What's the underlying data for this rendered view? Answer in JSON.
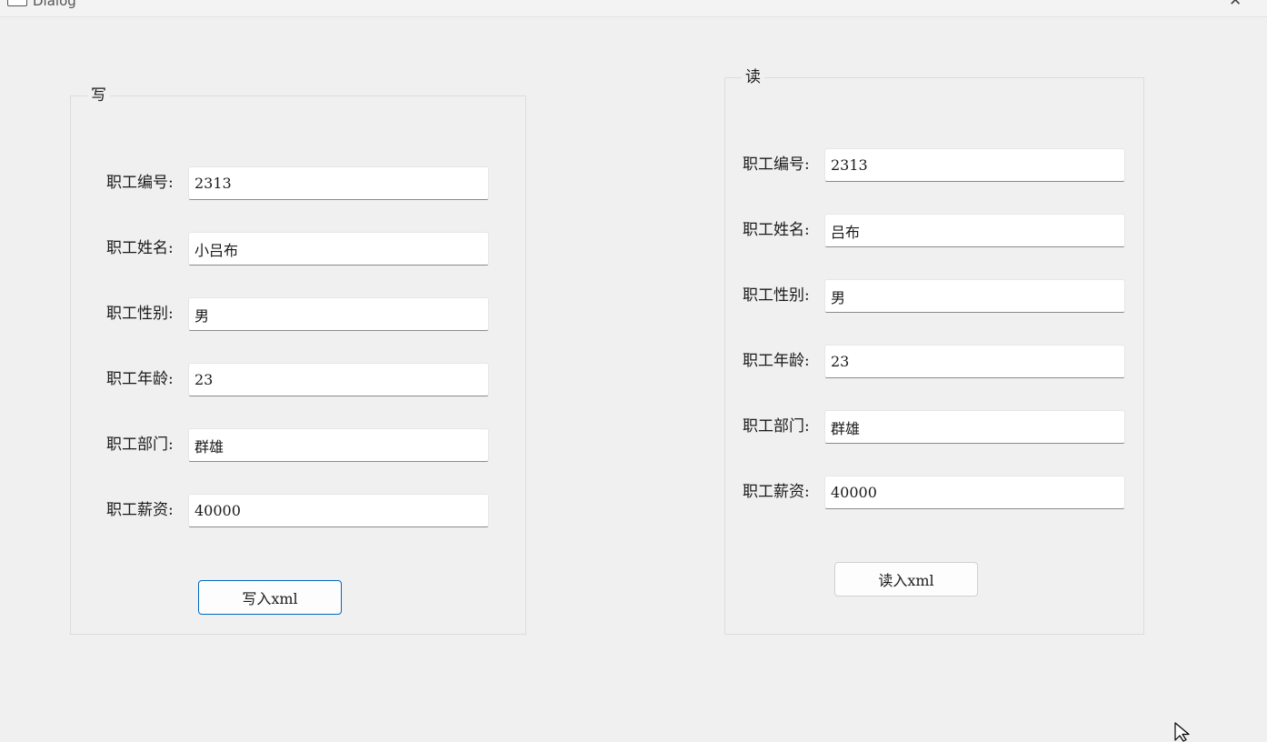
{
  "window": {
    "title": "Dialog",
    "minimize_glyph": "–",
    "close_glyph": "✕"
  },
  "write_group": {
    "title": "写",
    "fields": [
      {
        "label": "职工编号:",
        "value": "2313"
      },
      {
        "label": "职工姓名:",
        "value": "小吕布"
      },
      {
        "label": "职工性别:",
        "value": "男"
      },
      {
        "label": "职工年龄:",
        "value": "23"
      },
      {
        "label": "职工部门:",
        "value": "群雄"
      },
      {
        "label": "职工薪资:",
        "value": "40000"
      }
    ],
    "button_label": "写入xml"
  },
  "read_group": {
    "title": "读",
    "fields": [
      {
        "label": "职工编号:",
        "value": "2313"
      },
      {
        "label": "职工姓名:",
        "value": "吕布"
      },
      {
        "label": "职工性别:",
        "value": "男"
      },
      {
        "label": "职工年龄:",
        "value": "23"
      },
      {
        "label": "职工部门:",
        "value": "群雄"
      },
      {
        "label": "职工薪资:",
        "value": "40000"
      }
    ],
    "button_label": "读入xml"
  },
  "colors": {
    "background": "#f0f0f0",
    "default_button_border": "#0067c0"
  },
  "icons": {
    "window": "window-icon",
    "cursor": "mouse-pointer-icon"
  }
}
